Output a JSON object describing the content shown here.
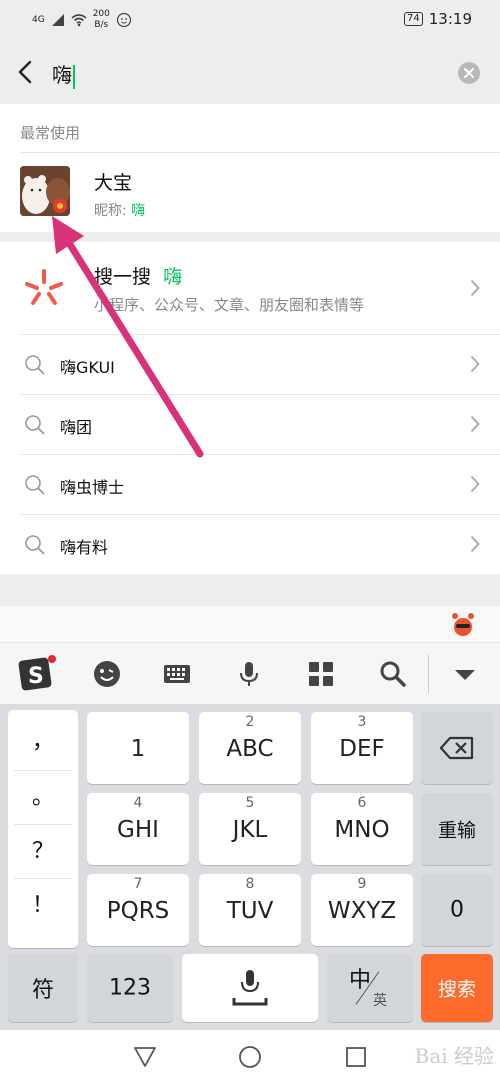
{
  "status_bar": {
    "network": "4G",
    "speed_value": "200",
    "speed_unit": "B/s",
    "battery": "74",
    "time": "13:19"
  },
  "search": {
    "query": "嗨"
  },
  "recent": {
    "title": "最常使用",
    "contact_name": "大宝",
    "nickname_label": "昵称: ",
    "nickname_value": "嗨"
  },
  "souyisou": {
    "title": "搜一搜",
    "keyword": "嗨",
    "subtitle": "小程序、公众号、文章、朋友圈和表情等"
  },
  "suggestions": [
    "嗨GKUI",
    "嗨团",
    "嗨虫博士",
    "嗨有料"
  ],
  "keyboard": {
    "punctuation": [
      "，",
      "。",
      "？",
      "！"
    ],
    "keys": [
      {
        "num": "",
        "letters": "1"
      },
      {
        "num": "2",
        "letters": "ABC"
      },
      {
        "num": "3",
        "letters": "DEF"
      },
      {
        "num": "4",
        "letters": "GHI"
      },
      {
        "num": "5",
        "letters": "JKL"
      },
      {
        "num": "6",
        "letters": "MNO"
      },
      {
        "num": "7",
        "letters": "PQRS"
      },
      {
        "num": "8",
        "letters": "TUV"
      },
      {
        "num": "9",
        "letters": "WXYZ"
      }
    ],
    "reinput": "重输",
    "zero": "0",
    "symbols": "符",
    "numbers": "123",
    "lang_main": "中",
    "lang_sub": "英",
    "search": "搜索"
  },
  "watermark": "Bai 经验",
  "colors": {
    "accent_green": "#07c160",
    "arrow_pink": "#d6337b",
    "search_key": "#fe6a2c"
  }
}
